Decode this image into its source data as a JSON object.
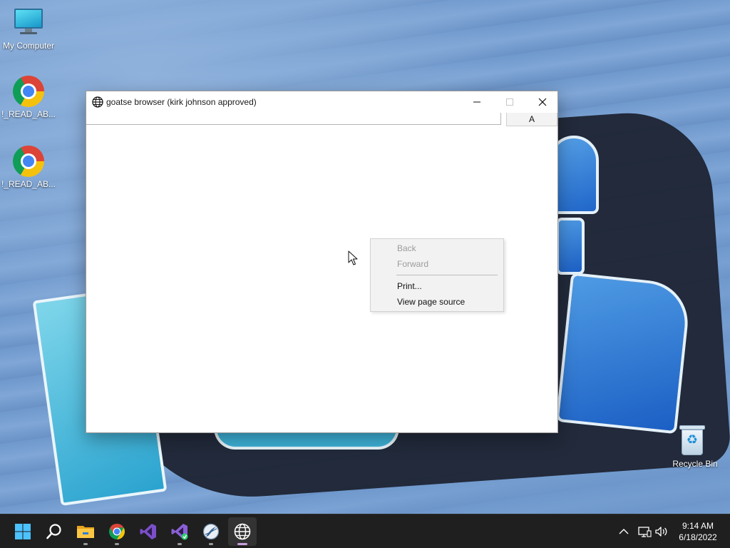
{
  "desktop": {
    "icons": [
      {
        "label": "My Computer",
        "icon": "computer-icon"
      },
      {
        "label": "!_READ_AB...",
        "icon": "chrome-icon"
      },
      {
        "label": "!_READ_AB...",
        "icon": "chrome-icon"
      },
      {
        "label": "Recycle Bin",
        "icon": "recycle-bin-icon"
      }
    ]
  },
  "window": {
    "title": "goatse browser (kirk johnson approved)",
    "icon": "globe-icon",
    "controls": {
      "minimize": "minimize-icon",
      "maximize": "maximize-icon",
      "close": "close-icon"
    },
    "address_value": "",
    "go_button_label": "A"
  },
  "context_menu": {
    "items": [
      {
        "label": "Back",
        "enabled": false
      },
      {
        "label": "Forward",
        "enabled": false
      },
      {
        "label": "Print...",
        "enabled": true
      },
      {
        "label": "View page source",
        "enabled": true
      }
    ]
  },
  "taskbar": {
    "items": [
      {
        "name": "start",
        "icon": "windows-start-icon"
      },
      {
        "name": "search",
        "icon": "search-icon"
      },
      {
        "name": "file-explorer",
        "icon": "folder-icon"
      },
      {
        "name": "chrome",
        "icon": "chrome-icon"
      },
      {
        "name": "visual-studio",
        "icon": "visual-studio-icon"
      },
      {
        "name": "visual-studio-installer",
        "icon": "visual-studio-installer-icon"
      },
      {
        "name": "app",
        "icon": "app-icon"
      },
      {
        "name": "browser",
        "icon": "globe-icon",
        "active": true
      }
    ],
    "tray": {
      "chevron": "chevron-up-icon",
      "network": "network-icon",
      "volume": "volume-icon"
    },
    "clock": {
      "time": "9:14 AM",
      "date": "6/18/2022"
    }
  },
  "colors": {
    "taskbar_bg": "#1f1f1f",
    "menu_bg": "#f2f2f2",
    "disabled_text": "#9c9c9c",
    "active_indicator": "#c9a0dc"
  }
}
